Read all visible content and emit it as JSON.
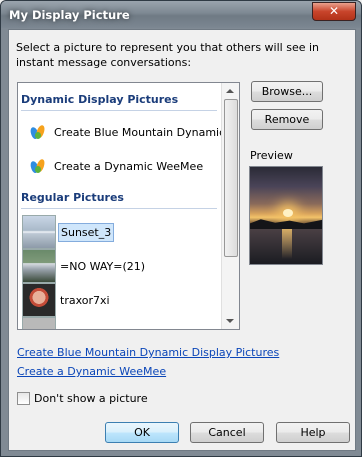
{
  "window": {
    "title": "My Display Picture",
    "close_glyph": "✕"
  },
  "intro_text": "Select a picture to represent you that others will see in instant message conversations:",
  "list": {
    "dynamic_header": "Dynamic Display Pictures",
    "dynamic_items": [
      {
        "label": "Create Blue Mountain Dynamic ...",
        "icon": "msn-butterfly-icon"
      },
      {
        "label": "Create a Dynamic WeeMee",
        "icon": "msn-butterfly-icon"
      }
    ],
    "regular_header": "Regular Pictures",
    "regular_items": [
      {
        "label": "Sunset_3",
        "selected": true
      },
      {
        "label": "=NO WAY=(21)",
        "selected": false
      },
      {
        "label": "traxor7xi",
        "selected": false
      },
      {
        "label": "",
        "selected": false
      }
    ]
  },
  "buttons": {
    "browse": "Browse...",
    "remove": "Remove",
    "ok": "OK",
    "cancel": "Cancel",
    "help": "Help"
  },
  "preview_label": "Preview",
  "links": {
    "blue_mountain": "Create Blue Mountain Dynamic Display Pictures",
    "weemee": "Create a Dynamic WeeMee"
  },
  "dont_show": {
    "label": "Don't show a picture",
    "checked": false
  },
  "colors": {
    "link": "#0b46b8",
    "section_header": "#1a3c7a",
    "selection": "#cfe6fb"
  }
}
